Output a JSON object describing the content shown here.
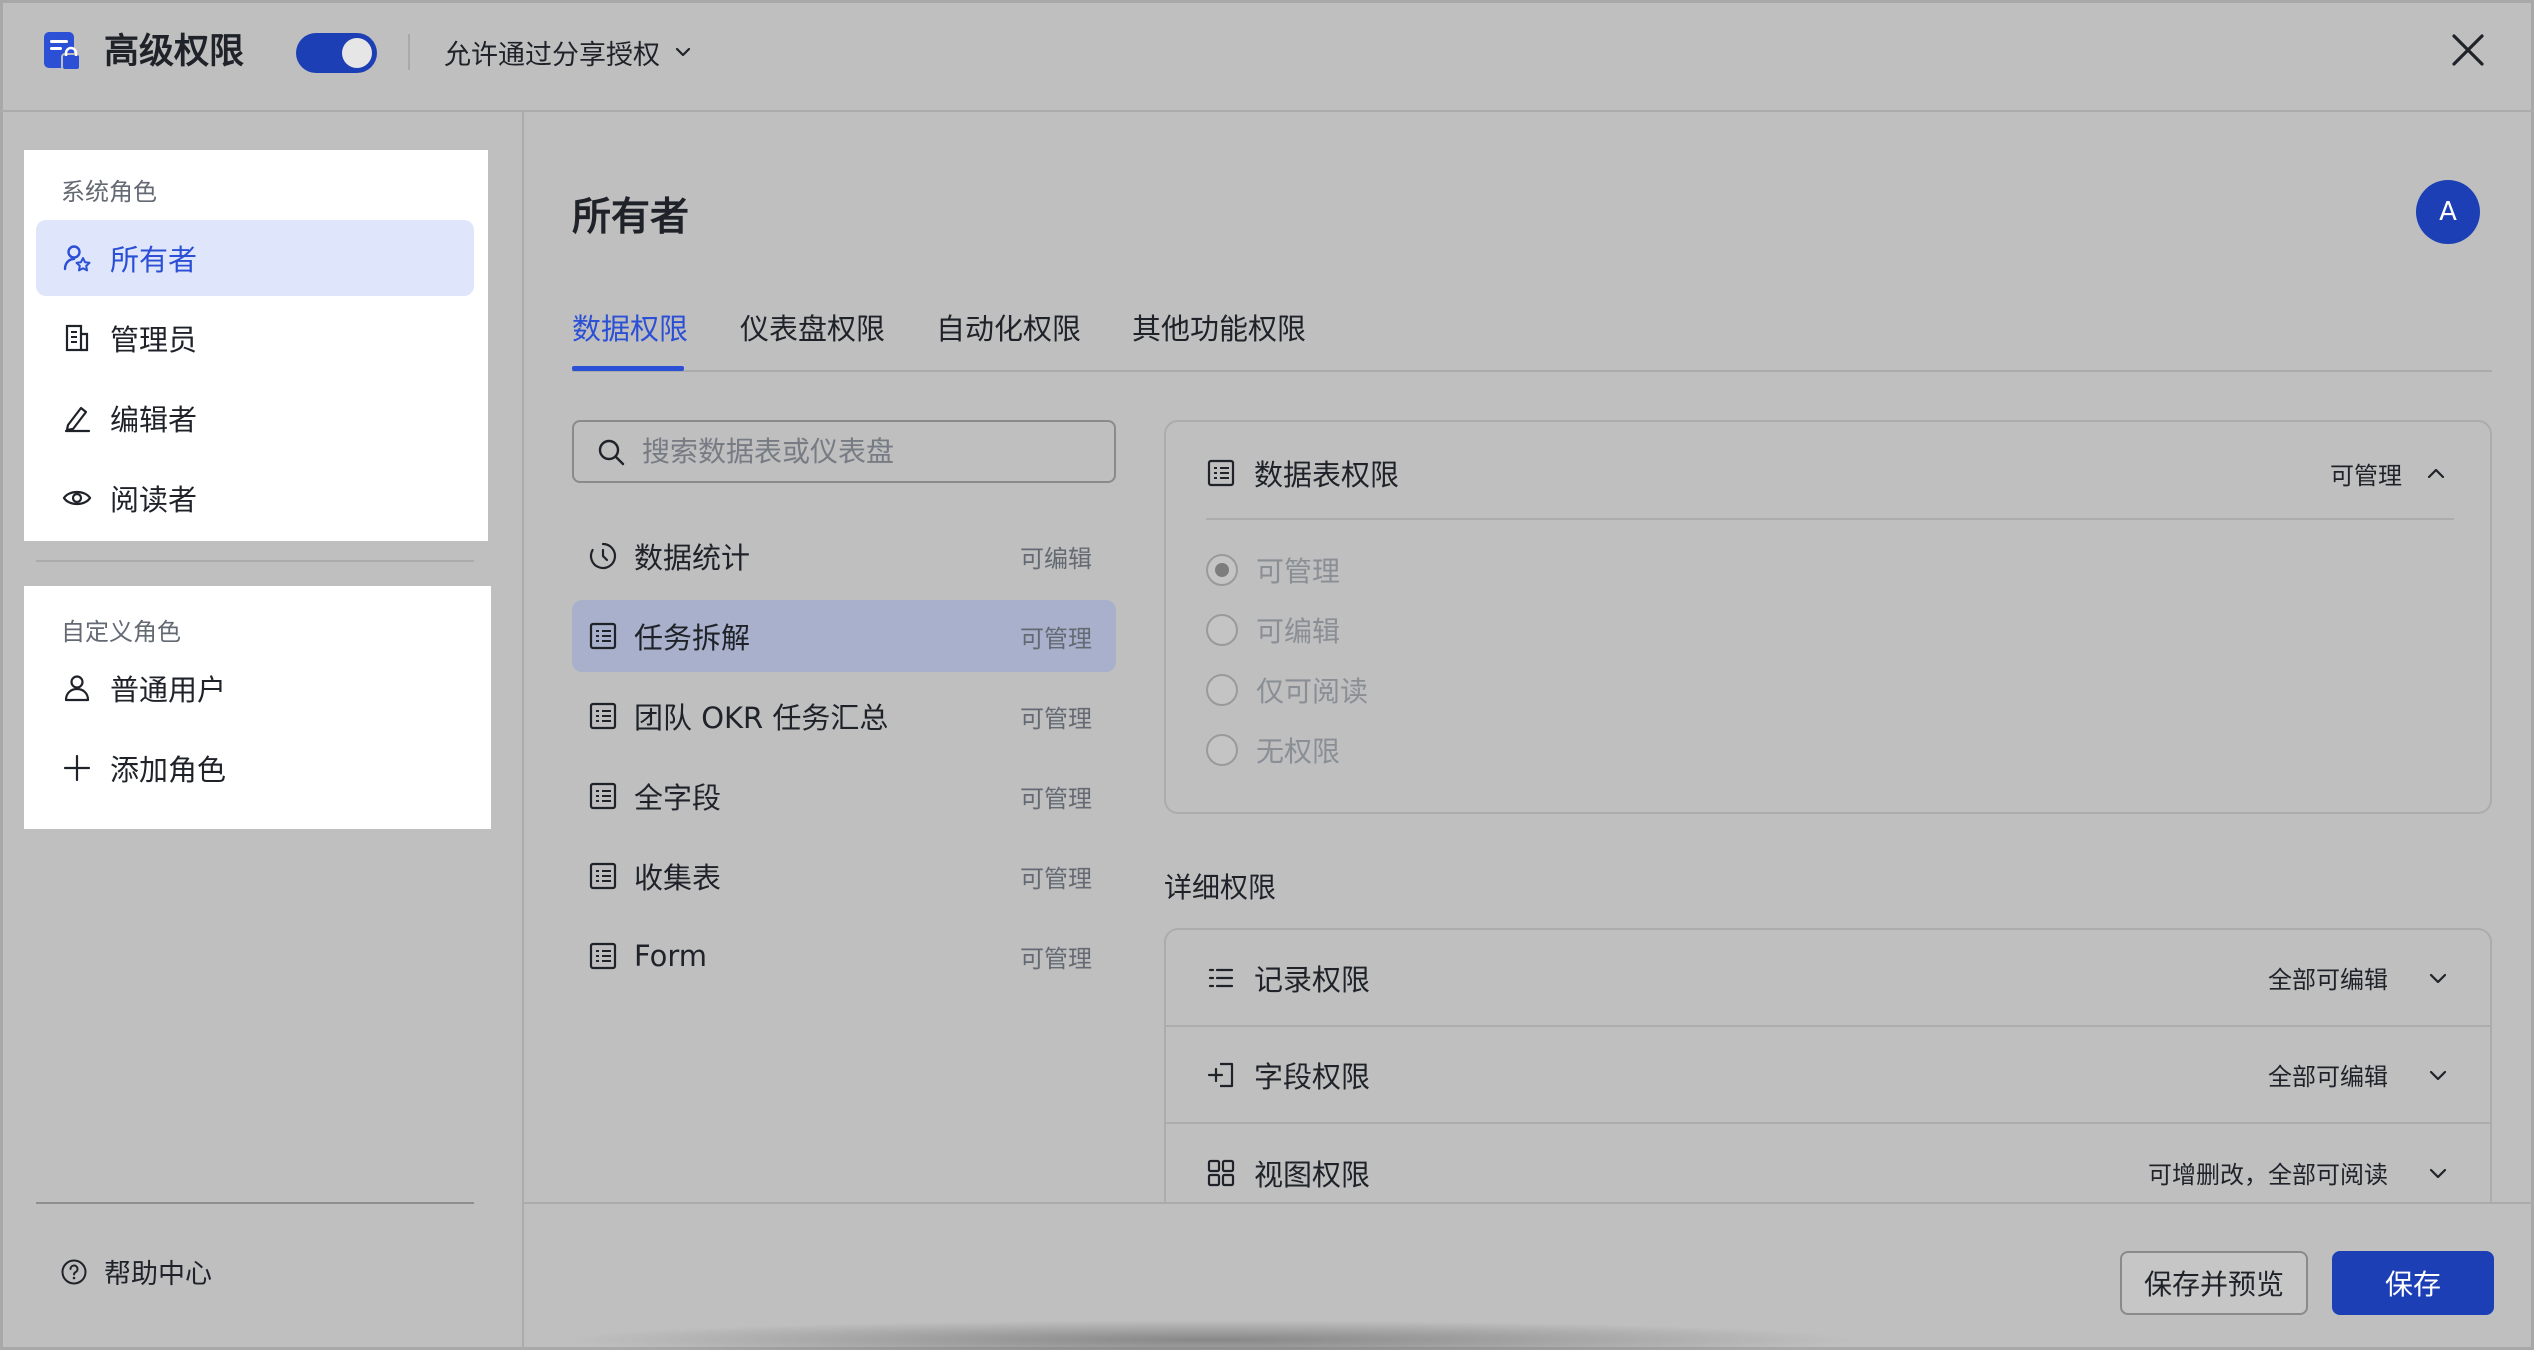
{
  "header": {
    "title": "高级权限",
    "toggle_on": true,
    "share_option": "允许通过分享授权"
  },
  "sidebar": {
    "system_group_label": "系统角色",
    "system_roles": [
      {
        "label": "所有者",
        "active": true
      },
      {
        "label": "管理员",
        "active": false
      },
      {
        "label": "编辑者",
        "active": false
      },
      {
        "label": "阅读者",
        "active": false
      }
    ],
    "custom_group_label": "自定义角色",
    "custom_roles": [
      {
        "label": "普通用户"
      },
      {
        "label": "添加角色"
      }
    ],
    "help_label": "帮助中心"
  },
  "main": {
    "title": "所有者",
    "avatar_letter": "A",
    "tabs": [
      {
        "label": "数据权限",
        "active": true
      },
      {
        "label": "仪表盘权限"
      },
      {
        "label": "自动化权限"
      },
      {
        "label": "其他功能权限"
      }
    ],
    "search_placeholder": "搜索数据表或仪表盘",
    "tables": [
      {
        "name": "数据统计",
        "perm": "可编辑",
        "icon": "dashboard-icon"
      },
      {
        "name": "任务拆解",
        "perm": "可管理",
        "icon": "table-icon",
        "active": true
      },
      {
        "name": "团队 OKR 任务汇总",
        "perm": "可管理",
        "icon": "table-icon"
      },
      {
        "name": "全字段",
        "perm": "可管理",
        "icon": "table-icon"
      },
      {
        "name": "收集表",
        "perm": "可管理",
        "icon": "table-icon"
      },
      {
        "name": "Form",
        "perm": "可管理",
        "icon": "table-icon"
      }
    ]
  },
  "panel": {
    "title": "数据表权限",
    "status": "可管理",
    "options": [
      {
        "label": "可管理",
        "checked": true
      },
      {
        "label": "可编辑"
      },
      {
        "label": "仅可阅读"
      },
      {
        "label": "无权限"
      }
    ]
  },
  "detail": {
    "label": "详细权限",
    "rows": [
      {
        "name": "记录权限",
        "value": "全部可编辑",
        "icon": "list-icon"
      },
      {
        "name": "字段权限",
        "value": "全部可编辑",
        "icon": "field-icon"
      },
      {
        "name": "视图权限",
        "value": "可增删改，全部可阅读",
        "icon": "grid-icon"
      }
    ]
  },
  "footer": {
    "save_preview_label": "保存并预览",
    "save_label": "保存"
  },
  "colors": {
    "accent": "#2b50d6",
    "primary_button": "#1d3fb5",
    "overlay_background": "#bfbfbf"
  }
}
